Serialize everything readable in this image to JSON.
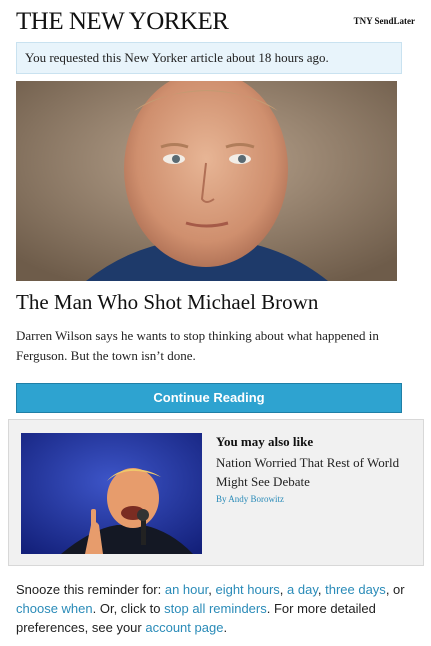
{
  "header": {
    "logo": "THE NEW YORKER",
    "tag": "TNY SendLater"
  },
  "notice": {
    "text": "You requested this New Yorker article about 18 hours ago."
  },
  "article": {
    "title": "The Man Who Shot Michael Brown",
    "dek": "Darren Wilson says he wants to stop thinking about what happened in Ferguson. But the town isn’t done.",
    "cta_label": "Continue Reading"
  },
  "related": {
    "heading": "You may also like",
    "title": "Nation Worried That Rest of World Might See Debate",
    "byline": "By Andy Borowitz"
  },
  "footer": {
    "t1": "Snooze this reminder for: ",
    "link_hour": "an hour",
    "sep1": ", ",
    "link_eight": "eight hours",
    "sep2": ", ",
    "link_day": "a day",
    "sep3": ", ",
    "link_three": "three days",
    "t2": ", or ",
    "link_choose": "choose when",
    "t3": ". Or, click to ",
    "link_stop": "stop all reminders",
    "t4": ". For more detailed preferences, see your ",
    "link_account": "account page",
    "t5": "."
  }
}
